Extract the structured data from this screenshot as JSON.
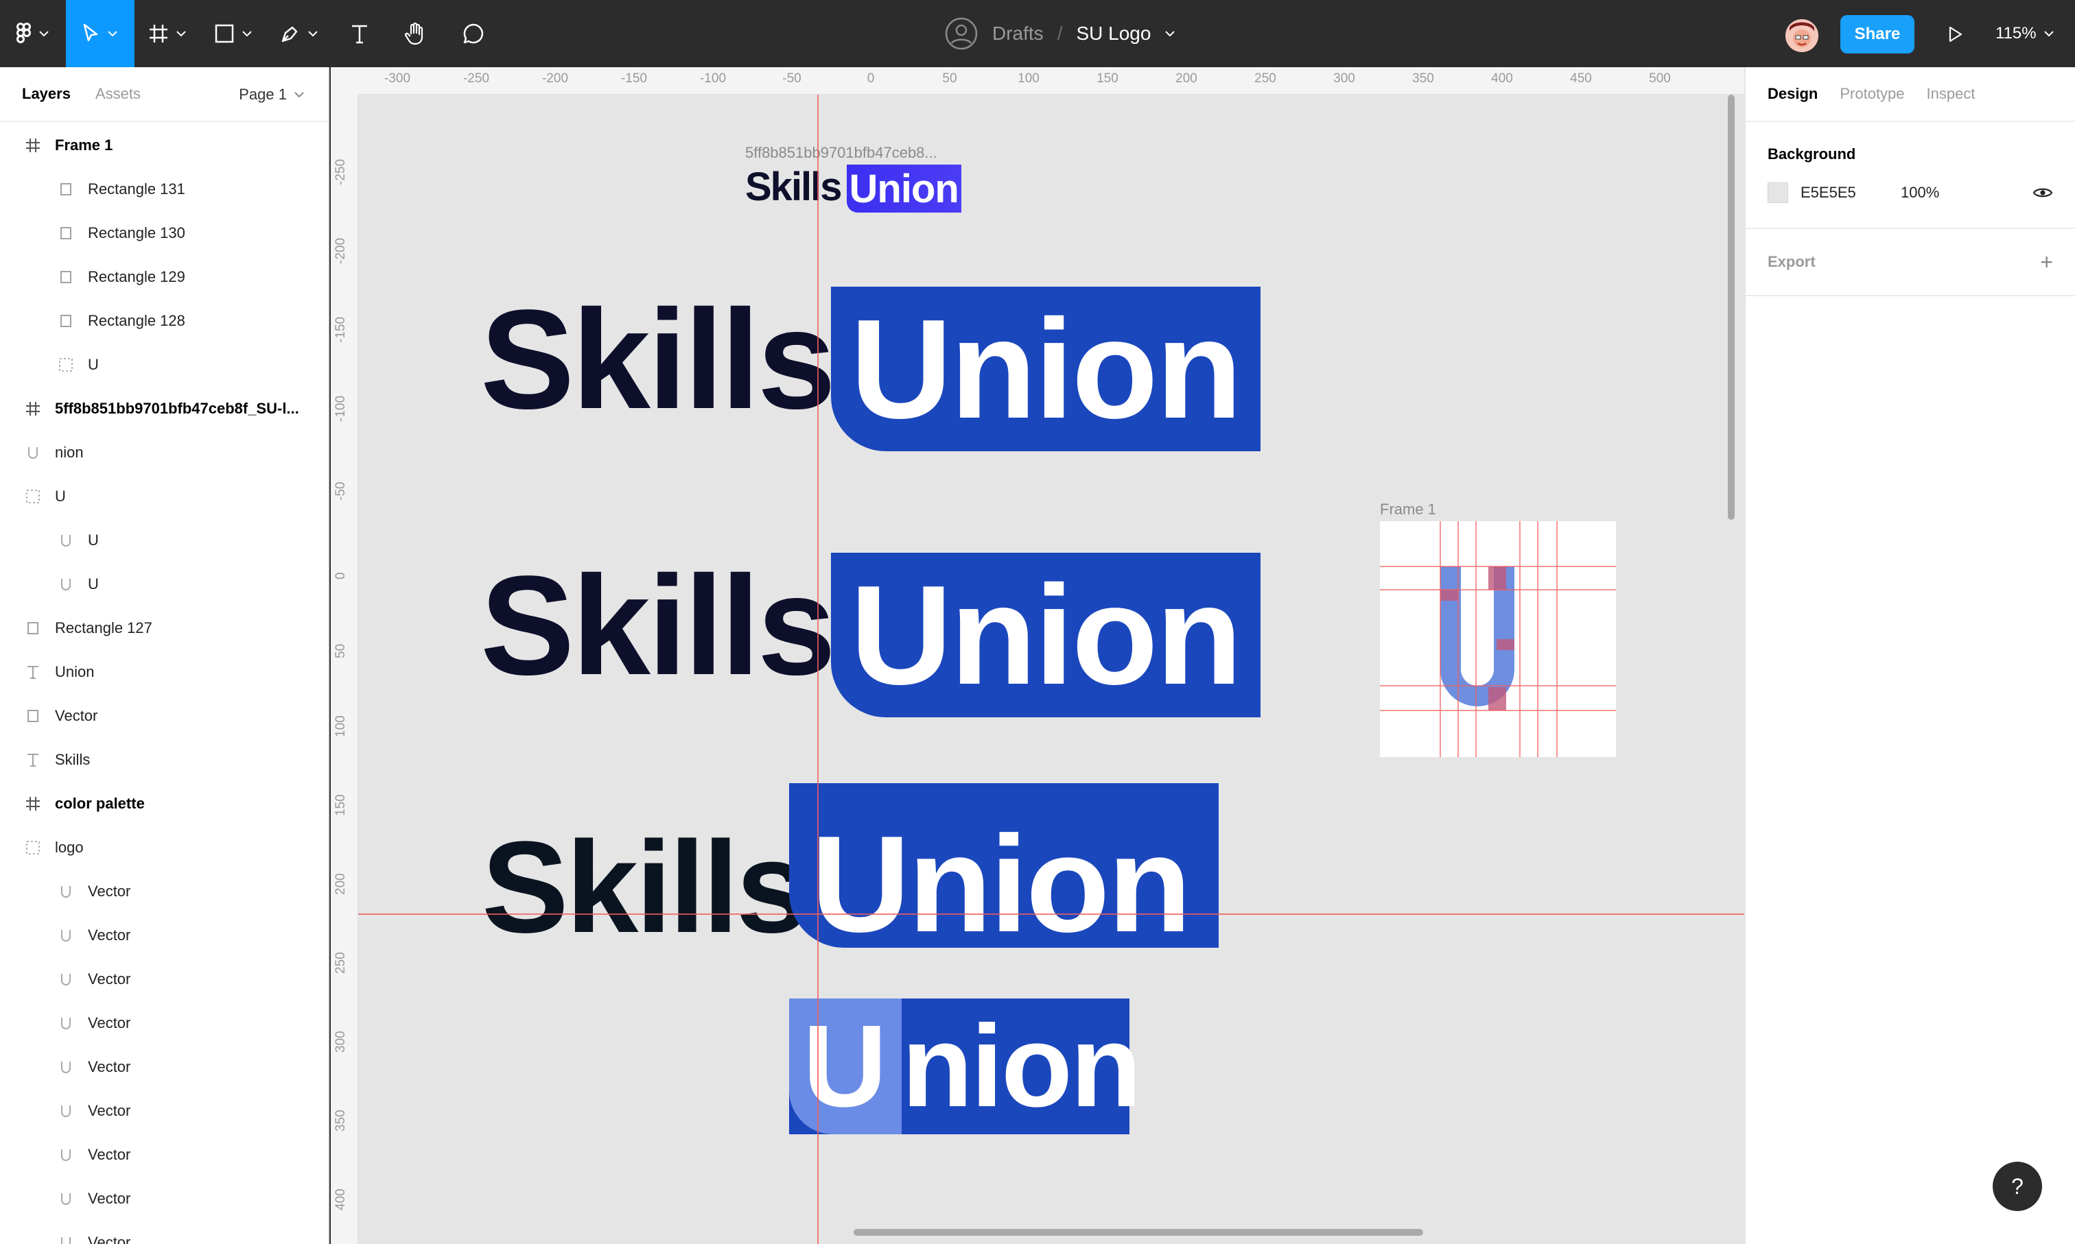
{
  "toolbar": {
    "breadcrumb_root": "Drafts",
    "breadcrumb_sep": "/",
    "file_title": "SU Logo",
    "share_label": "Share",
    "zoom_label": "115%"
  },
  "left_panel": {
    "tab_layers": "Layers",
    "tab_assets": "Assets",
    "page_label": "Page 1",
    "layers": [
      {
        "label": "Frame 1",
        "icon": "frame-icon",
        "level": 0,
        "bold": true
      },
      {
        "label": "Rectangle 131",
        "icon": "rectangle-icon",
        "level": 1
      },
      {
        "label": "Rectangle 130",
        "icon": "rectangle-icon",
        "level": 1
      },
      {
        "label": "Rectangle 129",
        "icon": "rectangle-icon",
        "level": 1
      },
      {
        "label": "Rectangle 128",
        "icon": "rectangle-icon",
        "level": 1
      },
      {
        "label": "U",
        "icon": "group-icon",
        "level": 1
      },
      {
        "label": "5ff8b851bb9701bfb47ceb8f_SU-l...",
        "icon": "frame-icon",
        "level": 0,
        "bold": true
      },
      {
        "label": "nion",
        "icon": "vector-icon",
        "level": 0
      },
      {
        "label": "U",
        "icon": "group-icon",
        "level": 0
      },
      {
        "label": "U",
        "icon": "vector-icon",
        "level": 1
      },
      {
        "label": "U",
        "icon": "vector-icon",
        "level": 1
      },
      {
        "label": "Rectangle 127",
        "icon": "rectangle-icon",
        "level": 0
      },
      {
        "label": "Union",
        "icon": "text-icon",
        "level": 0
      },
      {
        "label": "Vector",
        "icon": "rectangle-icon",
        "level": 0
      },
      {
        "label": "Skills",
        "icon": "text-icon",
        "level": 0
      },
      {
        "label": "color palette",
        "icon": "frame-icon",
        "level": 0,
        "bold": true
      },
      {
        "label": "logo",
        "icon": "group-icon",
        "level": 0
      },
      {
        "label": "Vector",
        "icon": "vector-icon",
        "level": 1
      },
      {
        "label": "Vector",
        "icon": "vector-icon",
        "level": 1
      },
      {
        "label": "Vector",
        "icon": "vector-icon",
        "level": 1
      },
      {
        "label": "Vector",
        "icon": "vector-icon",
        "level": 1
      },
      {
        "label": "Vector",
        "icon": "vector-icon",
        "level": 1
      },
      {
        "label": "Vector",
        "icon": "vector-icon",
        "level": 1
      },
      {
        "label": "Vector",
        "icon": "vector-icon",
        "level": 1
      },
      {
        "label": "Vector",
        "icon": "vector-icon",
        "level": 1
      },
      {
        "label": "Vector",
        "icon": "vector-icon",
        "level": 1
      }
    ]
  },
  "right_panel": {
    "tab_design": "Design",
    "tab_prototype": "Prototype",
    "tab_inspect": "Inspect",
    "background_title": "Background",
    "background_hex": "E5E5E5",
    "background_opacity": "100%",
    "export_title": "Export",
    "export_add": "+"
  },
  "canvas": {
    "ruler_top": [
      "-300",
      "-250",
      "-200",
      "-150",
      "-100",
      "-50",
      "0",
      "50",
      "100",
      "150",
      "200",
      "250",
      "300",
      "350",
      "400",
      "450",
      "500"
    ],
    "ruler_left": [
      "-250",
      "-200",
      "-150",
      "-100",
      "-50",
      "0",
      "50",
      "100",
      "150",
      "200",
      "250",
      "300",
      "350",
      "400"
    ],
    "frame_small_label": "5ff8b851bb9701bfb47ceb8...",
    "frame1_label": "Frame 1",
    "logo_skills": "Skills",
    "logo_union": "Union",
    "logo_nion": "nion",
    "logo_u": "U",
    "brand_blue": "#1b47bd",
    "brand_navy": "#0d0f2b",
    "guide_red": "#f25c5c",
    "canvas_bg": "#e5e5e5"
  },
  "help_label": "?"
}
